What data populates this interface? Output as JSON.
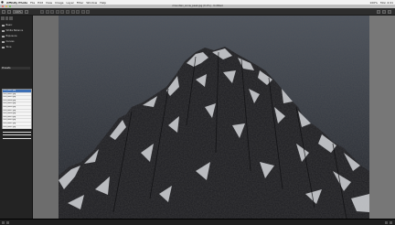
{
  "menubar": {
    "app_name": "Affinity Photo",
    "menus": [
      "File",
      "Edit",
      "View",
      "Image",
      "Layer",
      "Filter",
      "Window",
      "Help"
    ],
    "clock": "Mon 4:41",
    "status_text": "100%"
  },
  "window": {
    "title": "mountain_snow_peak.jpg (0.1%) - Untitled"
  },
  "toolbar": {
    "zoom_label": "100%",
    "icons": [
      "rotate-icon",
      "crop-icon",
      "brush-icon",
      "eye-icon",
      "clone-icon",
      "heal-icon",
      "dodge-icon",
      "text-icon",
      "shape-icon",
      "pen-icon"
    ]
  },
  "sidebar": {
    "rows": [
      "Basic",
      "White Balance",
      "Exposure",
      "Curves",
      "Tone"
    ],
    "section": "Presets",
    "files": [
      "IMG_4821.jpg",
      "IMG_4822.jpg",
      "IMG_4823.jpg",
      "IMG_4824.jpg",
      "IMG_4825.jpg",
      "IMG_4826.jpg",
      "IMG_4827.jpg",
      "IMG_4828.jpg",
      "IMG_4829.jpg",
      "IMG_4830.jpg",
      "IMG_4831.jpg",
      "IMG_4832.jpg",
      "IMG_4833.jpg",
      "IMG_4834.jpg",
      "IMG_4835.jpg"
    ],
    "selected_index": 0
  },
  "colors": {
    "sky_top": "#4a505a",
    "sky_bottom": "#2b2f37",
    "rock": "#1b1b1e",
    "snow": "#d9dade"
  }
}
